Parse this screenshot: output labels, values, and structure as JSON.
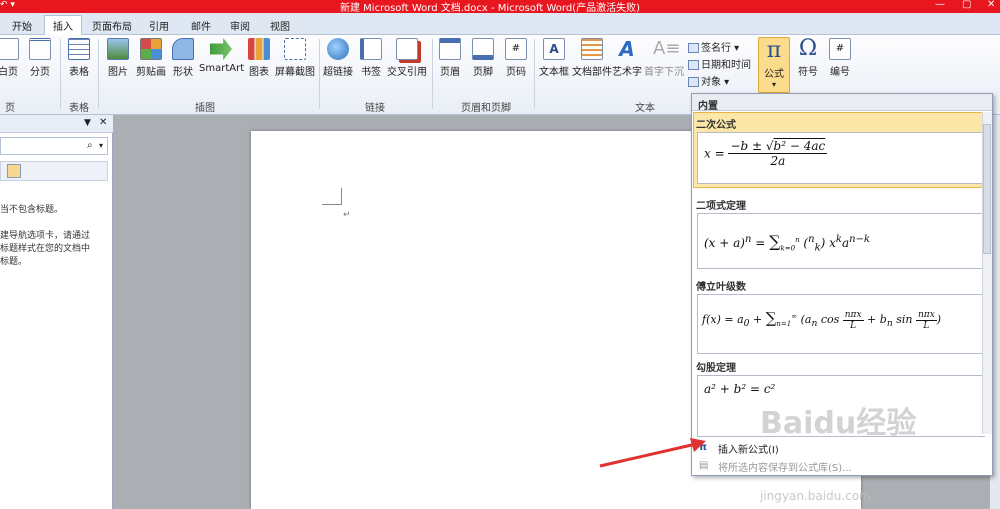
{
  "window": {
    "title": "新建 Microsoft Word 文档.docx  -  Microsoft Word(产品激活失败)"
  },
  "tabs": [
    "开始",
    "插入",
    "页面布局",
    "引用",
    "邮件",
    "审阅",
    "视图"
  ],
  "active_tab": "插入",
  "ribbon": {
    "groups": {
      "pages": "页",
      "table": "表格",
      "illustrations": "插图",
      "links": "链接",
      "header_footer": "页眉和页脚",
      "text": "文本"
    },
    "buttons": {
      "blank_page": "白页",
      "page_break": "分页",
      "table": "表格",
      "picture": "图片",
      "clipart": "剪贴画",
      "shapes": "形状",
      "smartart": "SmartArt",
      "chart": "图表",
      "screenshot": "屏幕截图",
      "hyperlink": "超链接",
      "bookmark": "书签",
      "cross_ref": "交叉引用",
      "header": "页眉",
      "footer": "页脚",
      "page_number": "页码",
      "textbox": "文本框",
      "quick_parts": "文档部件",
      "wordart": "艺术字",
      "dropcap": "首字下沉",
      "signature": "签名行",
      "datetime": "日期和时间",
      "object": "对象",
      "equation": "公式",
      "symbol": "符号",
      "number": "编号"
    }
  },
  "navpane": {
    "lines": [
      "当不包含标题。",
      "建导航选项卡，请通过",
      "标题样式在您的文档中",
      "标题。"
    ]
  },
  "equation_gallery": {
    "header": "内置",
    "items": [
      {
        "title": "二次公式"
      },
      {
        "title": "二项式定理"
      },
      {
        "title": "傅立叶级数"
      },
      {
        "title": "勾股定理"
      }
    ],
    "menu": {
      "insert_new": "插入新公式(I)",
      "save_selection": "将所选内容保存到公式库(S)..."
    }
  },
  "watermark": {
    "brand": "Baidu经验",
    "url": "jingyan.baidu.com"
  },
  "colors": {
    "titlebar": "#e8161e",
    "highlight": "#fde7a8",
    "arrow": "#e03030"
  }
}
